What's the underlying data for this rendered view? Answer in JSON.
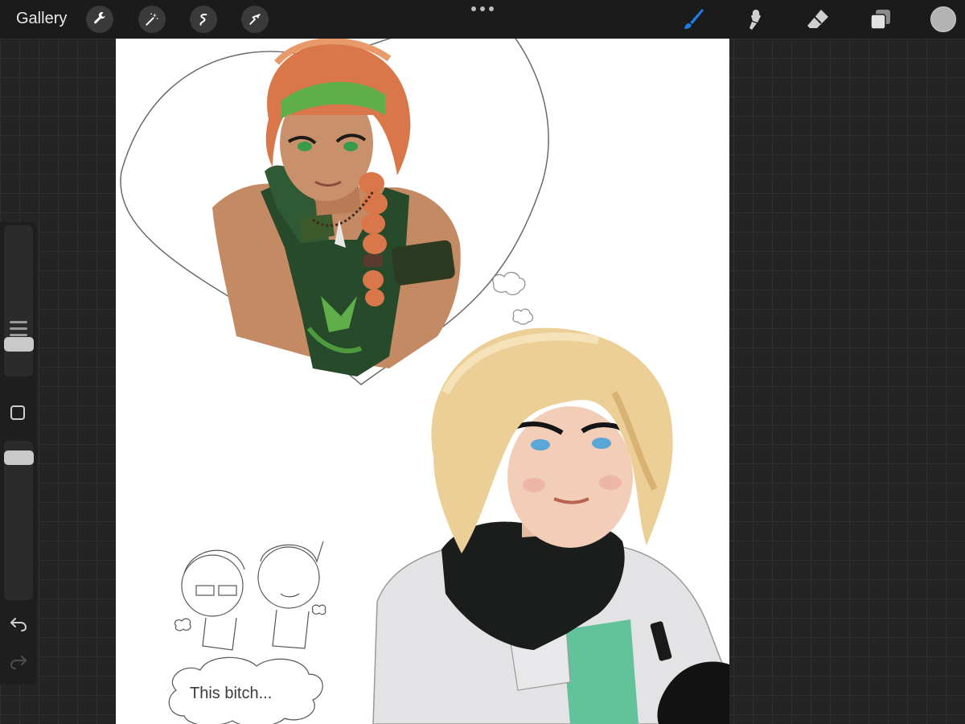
{
  "topbar": {
    "gallery_label": "Gallery",
    "left_tools": [
      "wrench-icon",
      "magic-wand-icon",
      "selection-icon",
      "transform-arrow-icon"
    ],
    "right_tools": [
      "brush-icon",
      "smudge-icon",
      "eraser-icon",
      "layers-icon",
      "color-swatch"
    ],
    "active_tool": "brush-icon"
  },
  "sidebar": {
    "brush_size_level": 0.16,
    "opacity_level": 0.55,
    "undo_icon": "undo-icon",
    "redo_icon": "redo-icon"
  },
  "canvas": {
    "bubble_text": "This bitch..."
  },
  "colors": {
    "toolbar_bg": "#1b1b1b",
    "workspace_bg": "#242424",
    "active_brush": "#1f7be8",
    "canvas_bg": "#ffffff"
  }
}
